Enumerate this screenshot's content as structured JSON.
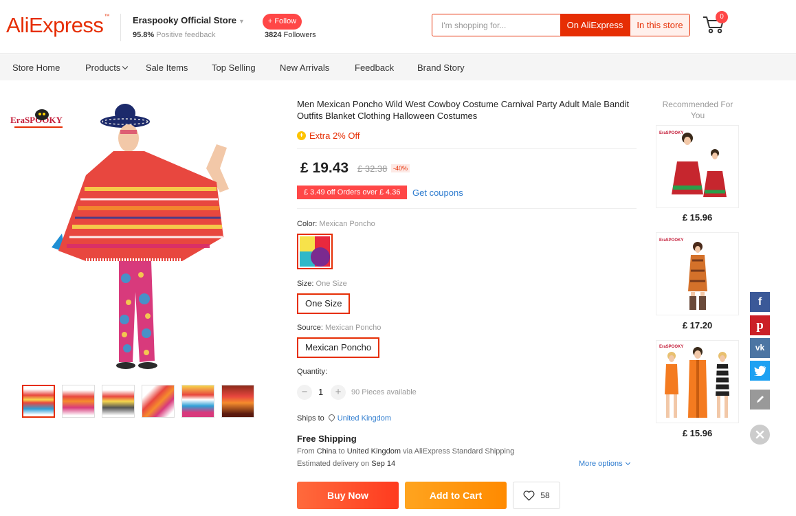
{
  "header": {
    "logo": "AliExpress",
    "store_name": "Eraspooky Official Store",
    "feedback_pct": "95.8%",
    "feedback_label": "Positive feedback",
    "follow_label": "+ Follow",
    "followers_count": "3824",
    "followers_label": "Followers",
    "search_placeholder": "I'm shopping for...",
    "search_ali_label": "On AliExpress",
    "search_store_label": "In this store",
    "cart_count": "0"
  },
  "nav": {
    "items": [
      "Store Home",
      "Products",
      "Sale Items",
      "Top Selling",
      "New Arrivals",
      "Feedback",
      "Brand Story"
    ]
  },
  "product": {
    "brand_logo": "EraSPOOKY",
    "title": "Men Mexican Poncho Wild West Cowboy Costume Carnival Party Adult Male Bandit Outfits Blanket Clothing Halloween Costumes",
    "extra_off": "Extra 2% Off",
    "price": "£ 19.43",
    "old_price": "£ 32.38",
    "discount": "-40%",
    "coupon": "£ 3.49 off Orders over  £ 4.36",
    "get_coupons": "Get coupons",
    "color_label": "Color:",
    "color_value": "Mexican Poncho",
    "size_label": "Size:",
    "size_value": "One Size",
    "size_option": "One Size",
    "source_label": "Source:",
    "source_value": "Mexican Poncho",
    "source_option": "Mexican Poncho",
    "quantity_label": "Quantity:",
    "quantity_value": "1",
    "pieces_available": "90 Pieces available",
    "ships_to_label": "Ships to",
    "ships_to_country": "United Kingdom",
    "free_shipping": "Free Shipping",
    "ship_from_prefix": "From",
    "ship_from_country": "China",
    "ship_to_word": "to",
    "ship_to_country": "United Kingdom",
    "ship_via": "via AliExpress Standard Shipping",
    "delivery_prefix": "Estimated delivery on",
    "delivery_date": "Sep 14",
    "more_options": "More options",
    "buy_now": "Buy Now",
    "add_to_cart": "Add to Cart",
    "wish_count": "58",
    "thumb_count": 6
  },
  "recommendations": {
    "title": "Recommended For You",
    "items": [
      {
        "price": "£ 15.96"
      },
      {
        "price": "£ 17.20"
      },
      {
        "price": "£ 15.96"
      }
    ]
  },
  "share": {
    "items": [
      "facebook-icon",
      "pinterest-icon",
      "vk-icon",
      "twitter-icon",
      "edit-icon"
    ],
    "colors": {
      "facebook": "#3b5998",
      "pinterest": "#cb2027",
      "vk": "#4c75a3",
      "twitter": "#1da1f2",
      "edit": "#999999"
    }
  },
  "colors": {
    "accent": "#e62e04",
    "link": "#2e7ccf"
  }
}
